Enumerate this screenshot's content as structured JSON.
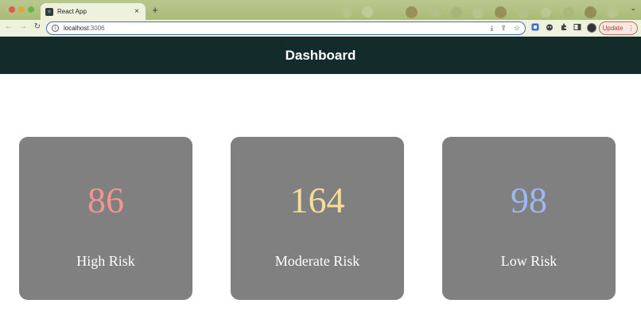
{
  "browser": {
    "tab_title": "React App",
    "url_prefix": "localhost",
    "url_port": ":3006",
    "update_label": "Update",
    "icons": {
      "close": "×",
      "new_tab": "+",
      "tab_menu": "⌄",
      "back": "←",
      "forward": "→",
      "reload": "↻",
      "info": "i",
      "install": "⤓",
      "share": "⇪",
      "bookmark": "☆",
      "kebab": "⋮"
    }
  },
  "header": {
    "title": "Dashboard",
    "background": "#142b2b"
  },
  "cards": [
    {
      "value": "86",
      "label": "High Risk",
      "color": "#f4938f"
    },
    {
      "value": "164",
      "label": "Moderate Risk",
      "color": "#f5dc97"
    },
    {
      "value": "98",
      "label": "Low Risk",
      "color": "#9bb8f0"
    }
  ],
  "card_background": "#808080"
}
